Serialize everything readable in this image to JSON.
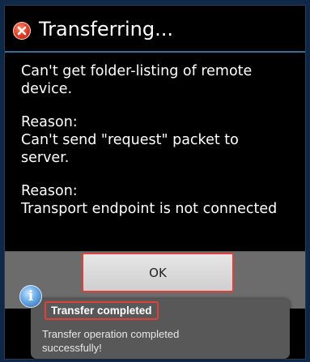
{
  "dialog": {
    "title": "Transferring...",
    "title_icon": "error-icon",
    "messages": [
      {
        "lines": [
          "Can't get folder-listing of remote",
          "device."
        ]
      },
      {
        "lines": [
          "Reason:",
          "Can't send \"request\" packet to",
          "server."
        ]
      },
      {
        "lines": [
          "Reason:",
          "Transport endpoint is not connected"
        ]
      }
    ],
    "ok_label": "OK"
  },
  "toast": {
    "icon": "info-icon",
    "icon_glyph": "i",
    "title": "Transfer completed",
    "body_lines": [
      "Transfer operation completed",
      "successfully!"
    ]
  },
  "colors": {
    "highlight": "#e0403a",
    "title_divider": "#2f6f9a",
    "button_bar": "#6c6c6c",
    "toast_bg": "#585858"
  }
}
